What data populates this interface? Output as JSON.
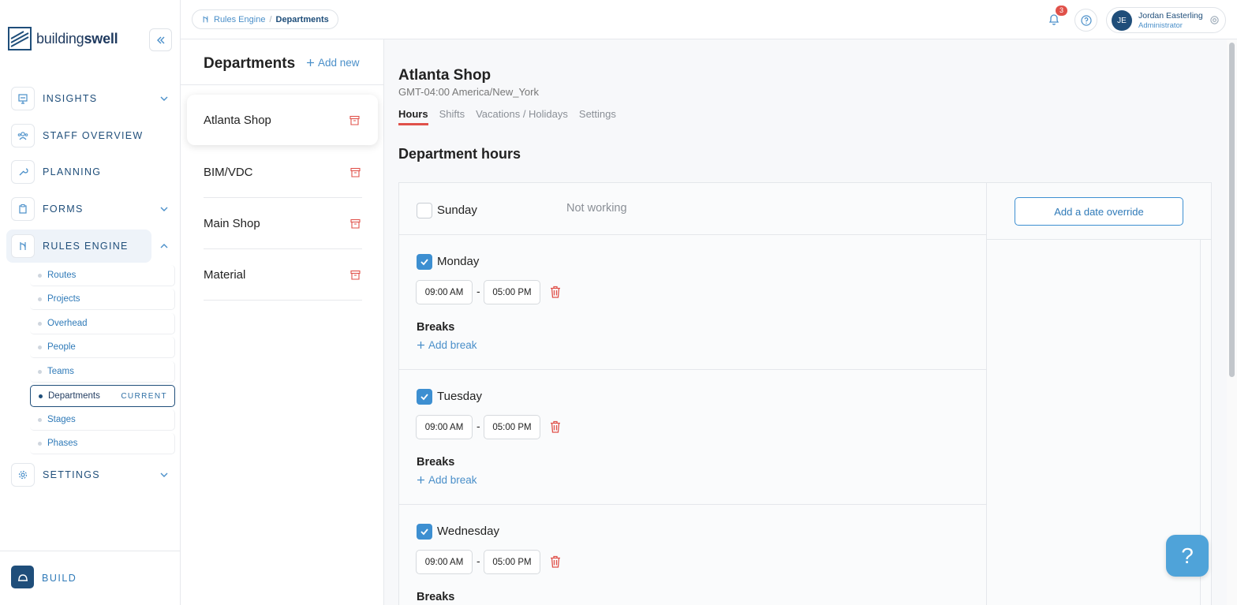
{
  "brand": {
    "name_regular": "building",
    "name_bold": "swell"
  },
  "sidebar": {
    "items": [
      {
        "label": "INSIGHTS",
        "icon": "presentation-icon"
      },
      {
        "label": "STAFF OVERVIEW",
        "icon": "users-icon"
      },
      {
        "label": "PLANNING",
        "icon": "wrench-icon"
      },
      {
        "label": "FORMS",
        "icon": "forms-icon"
      },
      {
        "label": "RULES ENGINE",
        "icon": "route-icon"
      },
      {
        "label": "SETTINGS",
        "icon": "gear-icon"
      }
    ],
    "subitems": [
      {
        "label": "Routes"
      },
      {
        "label": "Projects"
      },
      {
        "label": "Overhead"
      },
      {
        "label": "People"
      },
      {
        "label": "Teams"
      },
      {
        "label": "Departments",
        "tag": "CURRENT"
      },
      {
        "label": "Stages"
      },
      {
        "label": "Phases"
      }
    ],
    "bottom": {
      "label": "BUILD"
    }
  },
  "topbar": {
    "breadcrumb": {
      "parent": "Rules Engine",
      "separator": "/",
      "current": "Departments"
    },
    "notifications_count": "3",
    "user": {
      "initials": "JE",
      "name": "Jordan Easterling",
      "role": "Administrator"
    }
  },
  "departments": {
    "title": "Departments",
    "add_label": "Add new",
    "items": [
      {
        "name": "Atlanta Shop"
      },
      {
        "name": "BIM/VDC"
      },
      {
        "name": "Main Shop"
      },
      {
        "name": "Material"
      }
    ]
  },
  "detail": {
    "title": "Atlanta Shop",
    "timezone": "GMT-04:00 America/New_York",
    "tabs": [
      "Hours",
      "Shifts",
      "Vacations / Holidays",
      "Settings"
    ],
    "active_tab": "Hours",
    "section_title": "Department hours",
    "override_label": "Add a date override",
    "days": [
      {
        "name": "Sunday",
        "checked": false,
        "status": "Not working"
      },
      {
        "name": "Monday",
        "checked": true,
        "start": "09:00 AM",
        "end": "05:00 PM",
        "breaks_label": "Breaks",
        "add_break": "Add break"
      },
      {
        "name": "Tuesday",
        "checked": true,
        "start": "09:00 AM",
        "end": "05:00 PM",
        "breaks_label": "Breaks",
        "add_break": "Add break"
      },
      {
        "name": "Wednesday",
        "checked": true,
        "start": "09:00 AM",
        "end": "05:00 PM",
        "breaks_label": "Breaks"
      }
    ],
    "range_separator": "-"
  },
  "help_fab": "?",
  "colors": {
    "primary": "#1f4e7a",
    "accent": "#4a8fc9",
    "danger": "#e0514a",
    "checkbox": "#3d8fd1"
  }
}
